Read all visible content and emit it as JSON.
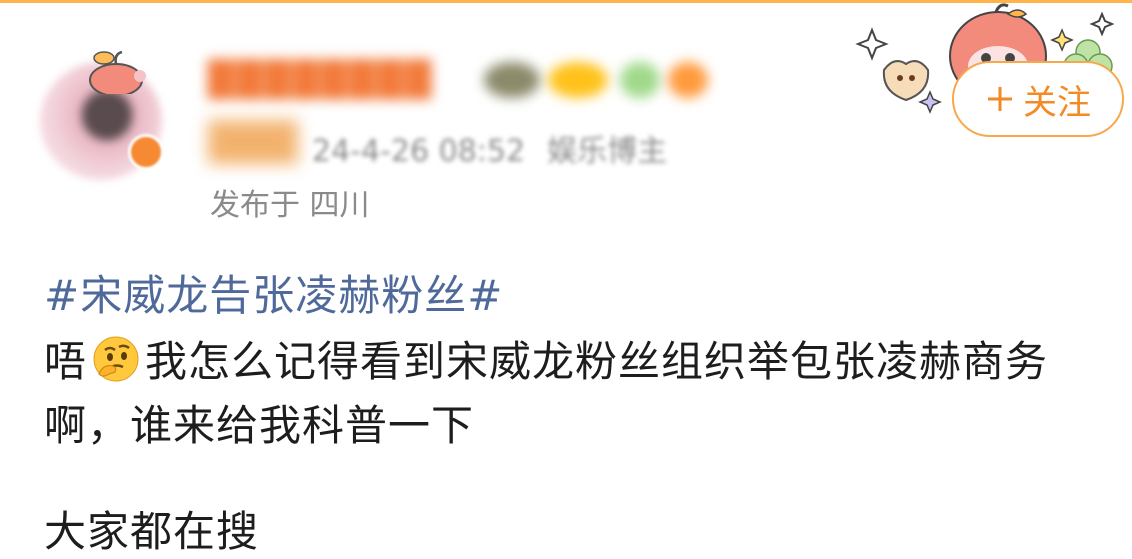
{
  "post": {
    "username_masked": "████████",
    "timestamp": "24-4-26 08:52",
    "source": "娱乐博主",
    "location": "发布于 四川",
    "follow_label": "关注",
    "follow_icon": "plus-icon",
    "hashtag": "#宋威龙告张凌赫粉丝#",
    "text_before_emoji": "唔",
    "emoji": "thinking-face-icon",
    "text_after_emoji": "我怎么记得看到宋威龙粉丝组织举包张凌赫商务啊，谁来给我科普一下",
    "next_line_partial": "大家都在搜"
  },
  "colors": {
    "accent_orange": "#f38a22",
    "hashtag_blue": "#4f6a9a",
    "meta_gray": "#8a8a8a",
    "text_dark": "#1d1d1d"
  }
}
